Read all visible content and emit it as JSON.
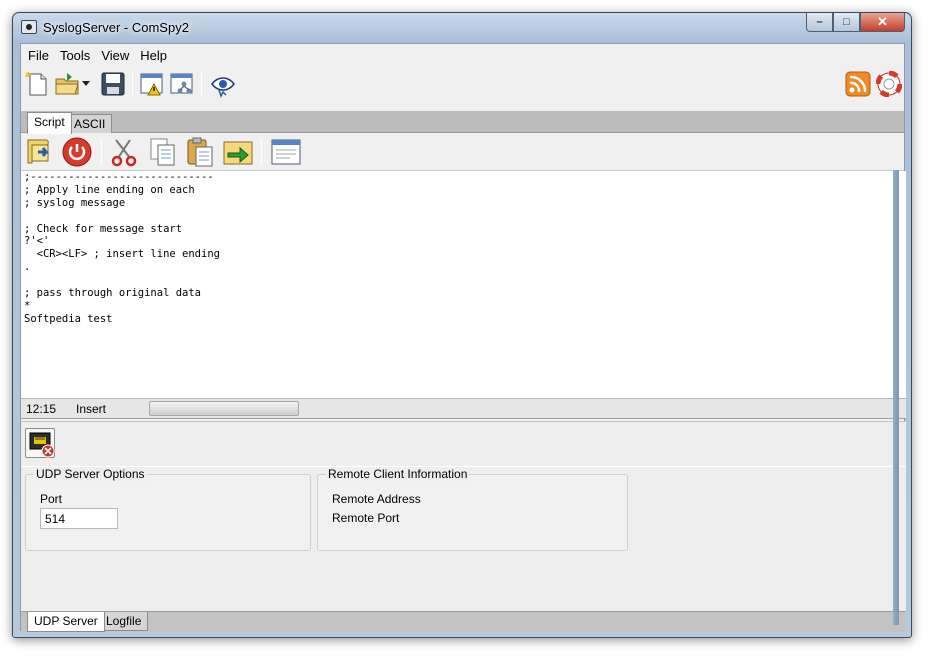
{
  "window": {
    "title": "SyslogServer - ComSpy2",
    "controls": {
      "minimize": "–",
      "maximize": "□",
      "close": "✕"
    }
  },
  "menu": [
    "File",
    "Tools",
    "View",
    "Help"
  ],
  "toolbar": {
    "icons": [
      "new-file-icon",
      "open-folder-icon",
      "dropdown-arrow-icon",
      "save-icon",
      "warning-window-icon",
      "network-window-icon",
      "monitor-eye-icon",
      "rss-feed-icon",
      "help-lifebuoy-icon"
    ]
  },
  "tabs_top": [
    "Script",
    "ASCII"
  ],
  "script_toolbar": {
    "icons": [
      "script-run-icon",
      "power-icon",
      "cut-icon",
      "copy-icon",
      "paste-icon",
      "insert-arrow-icon",
      "window-icon"
    ]
  },
  "editor": {
    "lines": [
      ";-----------------------------",
      "; Apply line ending on each",
      "; syslog message",
      "",
      "; Check for message start",
      "?'<'",
      "  <CR><LF> ; insert line ending",
      ".",
      "",
      "; pass through original data",
      "*",
      "Softpedia test"
    ]
  },
  "status": {
    "position": "12:15",
    "mode": "Insert"
  },
  "udp_options": {
    "title": "UDP Server Options",
    "port_label": "Port",
    "port_value": "514"
  },
  "remote_info": {
    "title": "Remote Client Information",
    "address_label": "Remote Address",
    "port_label": "Remote Port"
  },
  "tabs_bottom": [
    "UDP Server",
    "Logfile"
  ],
  "colors": {
    "title_bar": "#b7c9dd",
    "close_button": "#c4402a",
    "client_bg": "#f0f0f0",
    "editor_bg": "#ffffff"
  }
}
